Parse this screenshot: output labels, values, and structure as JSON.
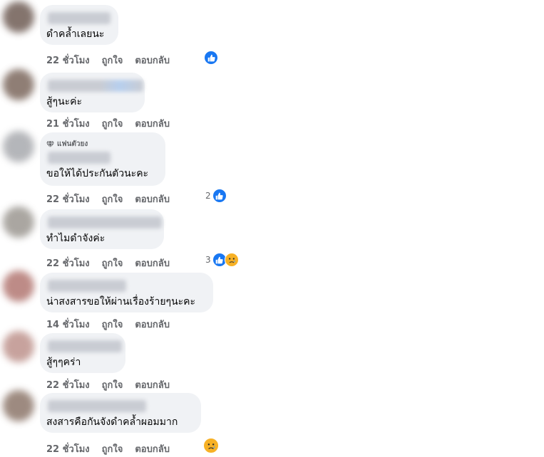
{
  "labels": {
    "like": "ถูกใจ",
    "reply": "ตอบกลับ"
  },
  "badge": {
    "icon": "diamond-icon",
    "text": "แฟนตัวยง"
  },
  "colors": {
    "like": "#1877f2",
    "sad": "#f7b125",
    "bubble": "#f0f2f5",
    "meta": "#65676b"
  },
  "comments": [
    {
      "text": "ดำคล้ำเลยนะ",
      "time": "22 ชั่วโมง",
      "reaction_count": "",
      "reactions": [
        "like-icon"
      ]
    },
    {
      "text": "สู้ๆนะค่ะ",
      "time": "21 ชั่วโมง",
      "reaction_count": "",
      "reactions": []
    },
    {
      "text": "ขอให้ได้ประกันตัวนะคะ",
      "time": "22 ชั่วโมง",
      "reaction_count": "2",
      "reactions": [
        "like-icon"
      ]
    },
    {
      "text": "ทำไมดำจังค่ะ",
      "time": "22 ชั่วโมง",
      "reaction_count": "3",
      "reactions": [
        "like-icon",
        "sad-icon"
      ]
    },
    {
      "text": "น่าสงสารขอให้ผ่านเรื่องร้ายๆนะคะ",
      "time": "14 ชั่วโมง",
      "reaction_count": "",
      "reactions": []
    },
    {
      "text": "สู้ๆๆคร่า",
      "time": "22 ชั่วโมง",
      "reaction_count": "",
      "reactions": []
    },
    {
      "text": "สงสารคือกันจังดำคล้ำผอมมาก",
      "time": "22 ชั่วโมง",
      "reaction_count": "",
      "reactions": [
        "sad-icon"
      ]
    }
  ]
}
